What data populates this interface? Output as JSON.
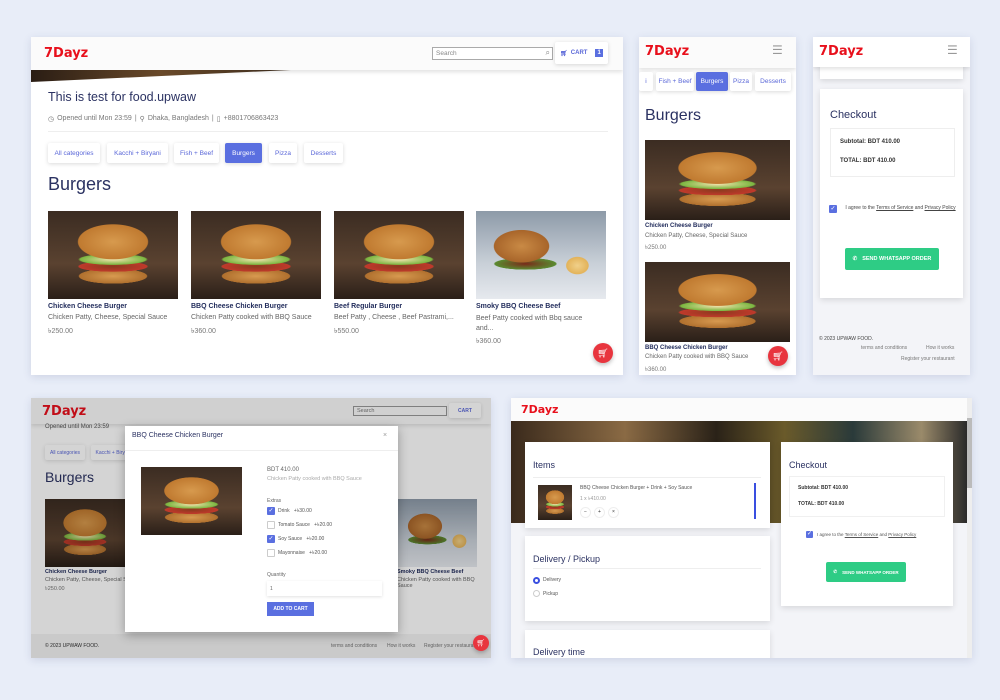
{
  "brand": "7Dayz",
  "colors": {
    "brand": "#e8101c",
    "accent": "#5a6fe0",
    "whatsapp": "#2ecc85",
    "fab": "#e8353e"
  },
  "desktop": {
    "search_placeholder": "Search",
    "cart_label": "CART",
    "cart_count": "1",
    "title": "This is test for food.upwaw",
    "opened": "Opened until Mon 23:59",
    "location": "Dhaka, Bangladesh",
    "phone": "+8801706863423",
    "sep": "|",
    "categories": [
      "All categories",
      "Kacchi + Biryani",
      "Fish + Beef",
      "Burgers",
      "Pizza",
      "Desserts"
    ],
    "active_category": "Burgers",
    "section_title": "Burgers",
    "items": [
      {
        "name": "Chicken Cheese Burger",
        "desc": "Chicken Patty, Cheese, Special Sauce",
        "price": "৳250.00"
      },
      {
        "name": "BBQ Cheese Chicken Burger",
        "desc": "Chicken Patty cooked with BBQ Sauce",
        "price": "৳360.00"
      },
      {
        "name": "Beef Regular Burger",
        "desc": "Beef Patty , Cheese , Beef Pastrami,...",
        "price": "৳550.00"
      },
      {
        "name": "Smoky BBQ Cheese Beef",
        "desc": "Beef Patty cooked with Bbq sauce and...",
        "price": "৳360.00"
      }
    ]
  },
  "mobile_menu": {
    "tabs": [
      "i",
      "Fish + Beef",
      "Burgers",
      "Pizza",
      "Desserts"
    ],
    "section_title": "Burgers"
  },
  "checkout": {
    "title": "Checkout",
    "subtotal": "Subtotal: BDT 410.00",
    "total": "TOTAL: BDT 410.00",
    "agree_prefix": "I agree to the",
    "terms": "Terms of Service",
    "and": "and",
    "privacy": "Privacy Policy",
    "send_label": "SEND WHATSAPP ORDER"
  },
  "footer": {
    "copyright": "© 2023 UPWAW FOOD.",
    "links": [
      "terms and conditions",
      "How it works",
      "Register your restaurant"
    ]
  },
  "modal": {
    "title": "BBQ Cheese Chicken Burger",
    "close": "×",
    "price": "BDT 410.00",
    "desc": "Chicken Patty cooked with BBQ Sauce",
    "extras_label": "Extras",
    "extras": [
      {
        "name": "Drink",
        "price": "+৳30.00",
        "checked": true
      },
      {
        "name": "Tomato Sauce",
        "price": "+৳20.00",
        "checked": false
      },
      {
        "name": "Soy Sauce",
        "price": "+৳20.00",
        "checked": true
      },
      {
        "name": "Mayonnaise",
        "price": "+৳20.00",
        "checked": false
      }
    ],
    "quantity_label": "Quantity",
    "quantity": "1",
    "add_label": "ADD TO CART"
  },
  "cart_page": {
    "items_title": "Items",
    "item_name": "BBQ Cheese Chicken Burger + Drink + Soy Sauce",
    "item_qty": "1 x ৳410.00",
    "qty_buttons": [
      "−",
      "+",
      "×"
    ],
    "delivery_title": "Delivery / Pickup",
    "options": [
      {
        "label": "Delivery",
        "selected": true
      },
      {
        "label": "Pickup",
        "selected": false
      }
    ],
    "time_title": "Delivery time"
  }
}
